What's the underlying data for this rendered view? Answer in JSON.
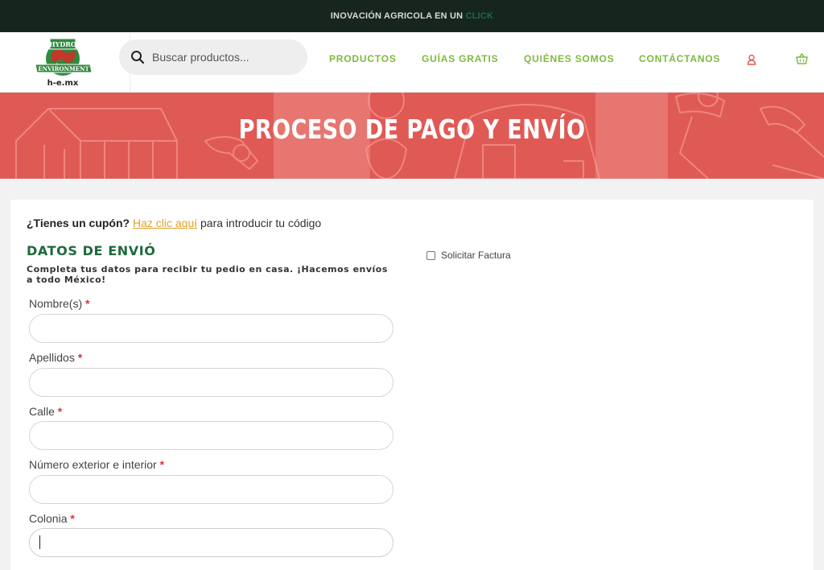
{
  "topbar": {
    "text": "INOVACIÓN AGRICOLA EN UN",
    "accent": "CLICK"
  },
  "logo": {
    "top": "HYDRO",
    "band": "ENVIRONMENT",
    "domain": "h-e.mx"
  },
  "search": {
    "placeholder": "Buscar productos..."
  },
  "nav": {
    "items": [
      "PRODUCTOS",
      "GUÍAS GRATIS",
      "QUIÉNES SOMOS",
      "CONTÁCTANOS"
    ]
  },
  "banner": {
    "title": "PROCESO DE PAGO Y ENVÍO"
  },
  "coupon": {
    "question": "¿Tienes un cupón?",
    "link": "Haz clic aquí",
    "rest": " para introducir tu código"
  },
  "shipping": {
    "title": "DATOS DE ENVIÓ",
    "subtitle": "Completa tus datos para recibir tu pedio en casa. ¡Hacemos envíos a todo México!",
    "required_mark": "*",
    "fields": [
      {
        "label": "Nombre(s)",
        "value": ""
      },
      {
        "label": "Apellidos",
        "value": ""
      },
      {
        "label": "Calle",
        "value": ""
      },
      {
        "label": "Número exterior e interior",
        "value": ""
      },
      {
        "label": "Colonia",
        "value": ""
      }
    ]
  },
  "invoice": {
    "label": "Solicitar Factura",
    "checked": false
  },
  "colors": {
    "topbar": "#16261e",
    "nav_green": "#7fba3c",
    "banner_red": "#e05a55",
    "title_green": "#1c6a3c",
    "link_orange": "#e0a22a",
    "required_red": "#d9333f"
  },
  "icons": {
    "search": "search-icon",
    "user": "user-icon",
    "cart": "cart-icon"
  }
}
